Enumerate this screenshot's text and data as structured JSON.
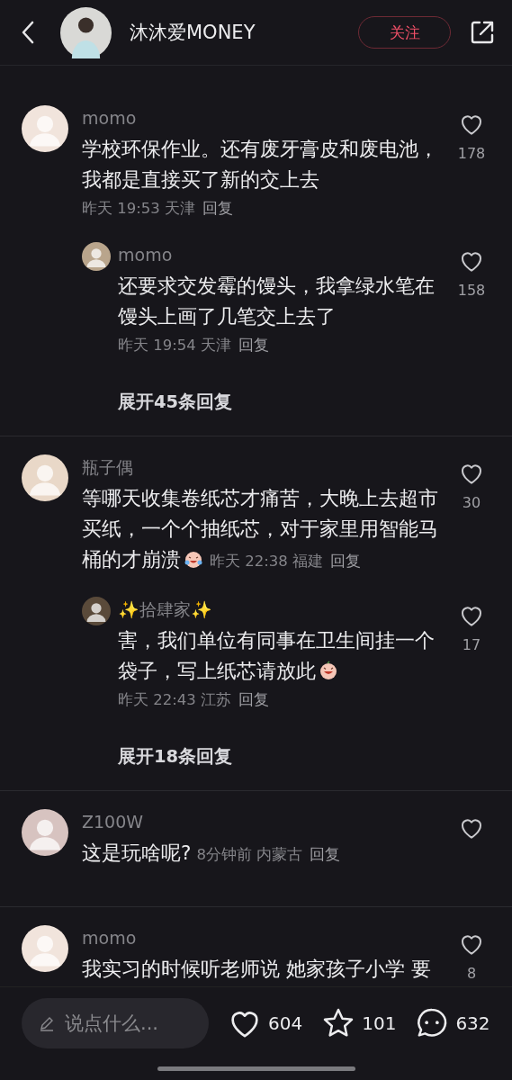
{
  "header": {
    "title": "沐沐爱MONEY",
    "follow_label": "关注"
  },
  "comments": [
    {
      "author": "momo",
      "kind": "stacked",
      "text": "学校环保作业。还有废牙膏皮和废电池，我都是直接买了新的交上去",
      "meta": "昨天 19:53 天津",
      "reply_label": "回复",
      "likes": "178",
      "replies": [
        {
          "author": "momo",
          "kind": "stacked",
          "text": "还要求交发霉的馒头，我拿绿水笔在馒头上画了几笔交上去了",
          "meta": "昨天 19:54 天津",
          "reply_label": "回复",
          "likes": "158"
        }
      ],
      "expand_label": "展开45条回复"
    },
    {
      "author": "瓶子偶",
      "kind": "inline",
      "text": "等哪天收集卷纸芯才痛苦，大晚上去超市买纸，一个个抽纸芯，对于家里用智能马桶的才崩溃",
      "emoji": {
        "kind": "crying-laugh"
      },
      "meta": "昨天 22:38 福建",
      "reply_label": "回复",
      "likes": "30",
      "replies": [
        {
          "author": "✨拾肆家✨",
          "kind": "stacked",
          "text": "害，我们单位有同事在卫生间挂一个袋子，写上纸芯请放此",
          "emoji": {
            "kind": "grin"
          },
          "meta": "昨天 22:43 江苏",
          "reply_label": "回复",
          "likes": "17"
        }
      ],
      "expand_label": "展开18条回复"
    },
    {
      "author": "Z100W",
      "kind": "inline",
      "text": "这是玩啥呢?",
      "meta": "8分钟前 内蒙古",
      "reply_label": "回复"
    },
    {
      "author": "momo",
      "kind": "plain",
      "text": "我实习的时候听老师说 她家孩子小学 要",
      "likes": "8"
    }
  ],
  "bottom_bar": {
    "placeholder": "说点什么...",
    "likes": "604",
    "favorites": "101",
    "comments": "632"
  }
}
